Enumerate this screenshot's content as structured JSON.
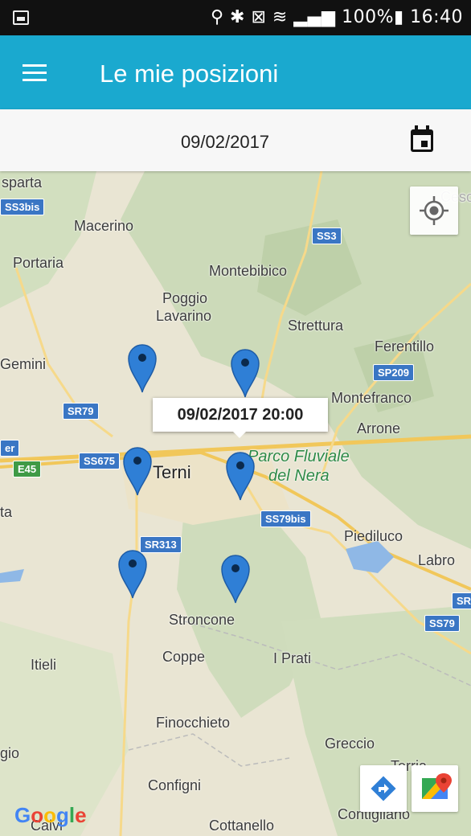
{
  "status_bar": {
    "text": "100%▮ 16:40",
    "icons": [
      "location-icon",
      "bluetooth-icon",
      "mute-icon",
      "wifi-icon",
      "signal-icon",
      "battery-icon"
    ]
  },
  "app_bar": {
    "title": "Le mie posizioni",
    "menu_icon": "hamburger-menu-icon",
    "color": "#1aa9cf"
  },
  "date_bar": {
    "date": "09/02/2017",
    "calendar_icon": "calendar-icon"
  },
  "map": {
    "place_labels": [
      "sparta",
      "Macerino",
      "Portaria",
      "Montebibico",
      "Poggio",
      "Lavarino",
      "Strettura",
      "Ferentillo",
      "Gemini",
      "Montefranco",
      "Arrone",
      "Terni",
      "Piediluco",
      "Labro",
      "Stroncone",
      "Coppe",
      "I Prati",
      "Itieli",
      "Finocchieto",
      "Greccio",
      "gio",
      "Terria",
      "Configni",
      "Contigliano",
      "Cottanello",
      "Calvi",
      "Ceso",
      "ta",
      "er"
    ],
    "park_label_1": "Parco Fluviale",
    "park_label_2": "del Nera",
    "road_shields": [
      "SS3bis",
      "SS3",
      "SP209",
      "SR79",
      "SS675",
      "E45",
      "SS79bis",
      "SR313",
      "SS79",
      "SR"
    ],
    "tooltip": "09/02/2017 20:00",
    "pin_count": 6,
    "pin_color": "#2f7fd6",
    "attribution": "Google",
    "buttons": {
      "my_location": "my-location-icon",
      "directions": "directions-icon",
      "open_maps": "google-maps-icon"
    }
  }
}
